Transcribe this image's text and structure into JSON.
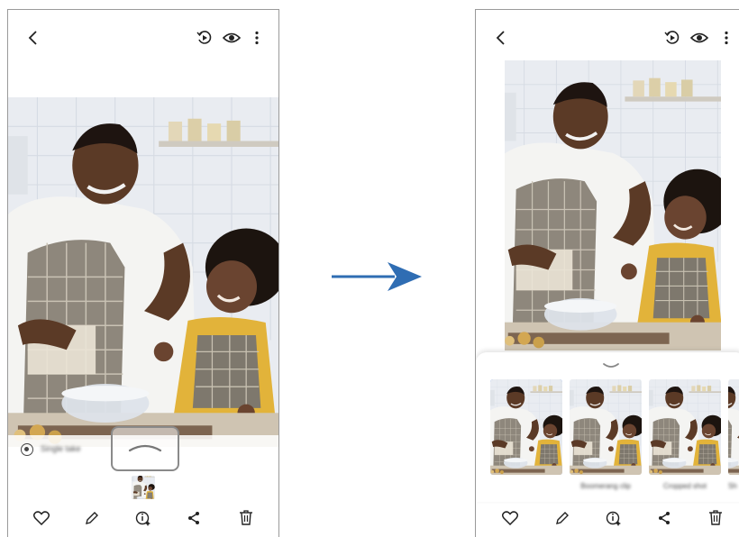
{
  "left_phone": {
    "topbar": {
      "back_icon": "chevron-left-icon",
      "motion_icon": "motion-photo-icon",
      "view_icon": "eye-icon",
      "more_icon": "more-vertical-icon"
    },
    "detected_label": "Single take",
    "bottom_actions": [
      "heart-icon",
      "pencil-icon",
      "info-icon",
      "share-icon",
      "trash-icon"
    ]
  },
  "right_phone": {
    "topbar": {
      "back_icon": "chevron-left-icon",
      "motion_icon": "motion-photo-icon",
      "view_icon": "eye-icon",
      "more_icon": "more-vertical-icon"
    },
    "thumbnails": [
      {
        "label": "",
        "selected": true,
        "crown": true
      },
      {
        "label": "Boomerang clip",
        "selected": false
      },
      {
        "label": "Cropped shot",
        "selected": false
      },
      {
        "label": "Sh",
        "selected": false
      }
    ],
    "bottom_actions": [
      "heart-icon",
      "pencil-icon",
      "info-icon",
      "share-icon",
      "trash-icon"
    ]
  },
  "colors": {
    "accent": "#3a6fd8",
    "arrow": "#2f6db3",
    "crown": "#f2c02a"
  }
}
